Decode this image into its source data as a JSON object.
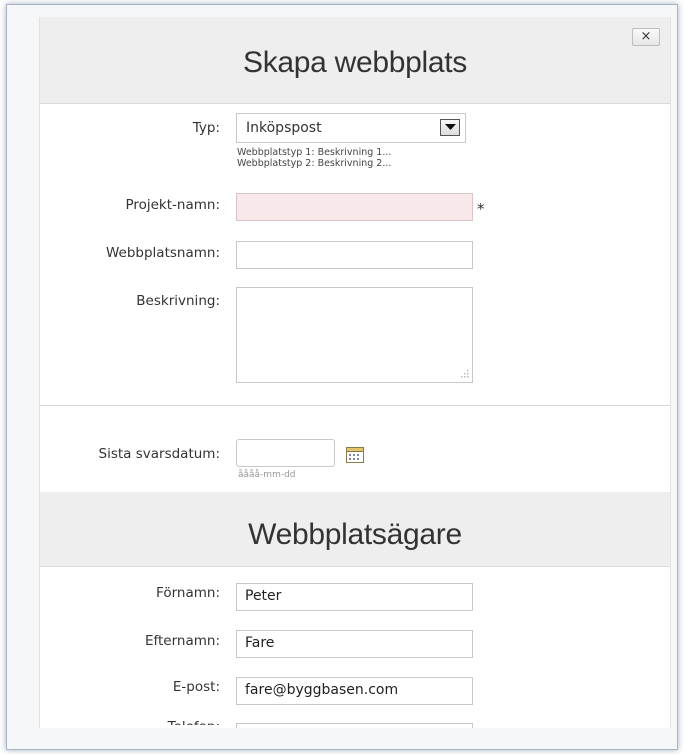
{
  "close_label": "×",
  "header_title": "Skapa webbplats",
  "fields": {
    "type_label": "Typ:",
    "type_value": "Inköpspost",
    "type_hints": [
      "Webbplatstyp 1: Beskrivning 1...",
      "Webbplatstyp 2: Beskrivning 2..."
    ],
    "project_label": "Projekt-namn:",
    "project_value": "",
    "required_marker": "*",
    "site_name_label": "Webbplatsnamn:",
    "site_name_value": "",
    "description_label": "Beskrivning:",
    "description_value": "",
    "deadline_label": "Sista svarsdatum:",
    "deadline_value": "",
    "deadline_hint": "åååå-mm-dd"
  },
  "owner_header": "Webbplatsägare",
  "owner": {
    "first_name_label": "Förnamn:",
    "first_name_value": "Peter",
    "last_name_label": "Efternamn:",
    "last_name_value": "Fare",
    "email_label": "E-post:",
    "email_value": "fare@byggbasen.com",
    "phone_label": "Telefon:"
  },
  "icons": {
    "select_arrow": "chevron-down-icon",
    "calendar": "calendar-icon",
    "resize": "resize-grip-icon"
  }
}
